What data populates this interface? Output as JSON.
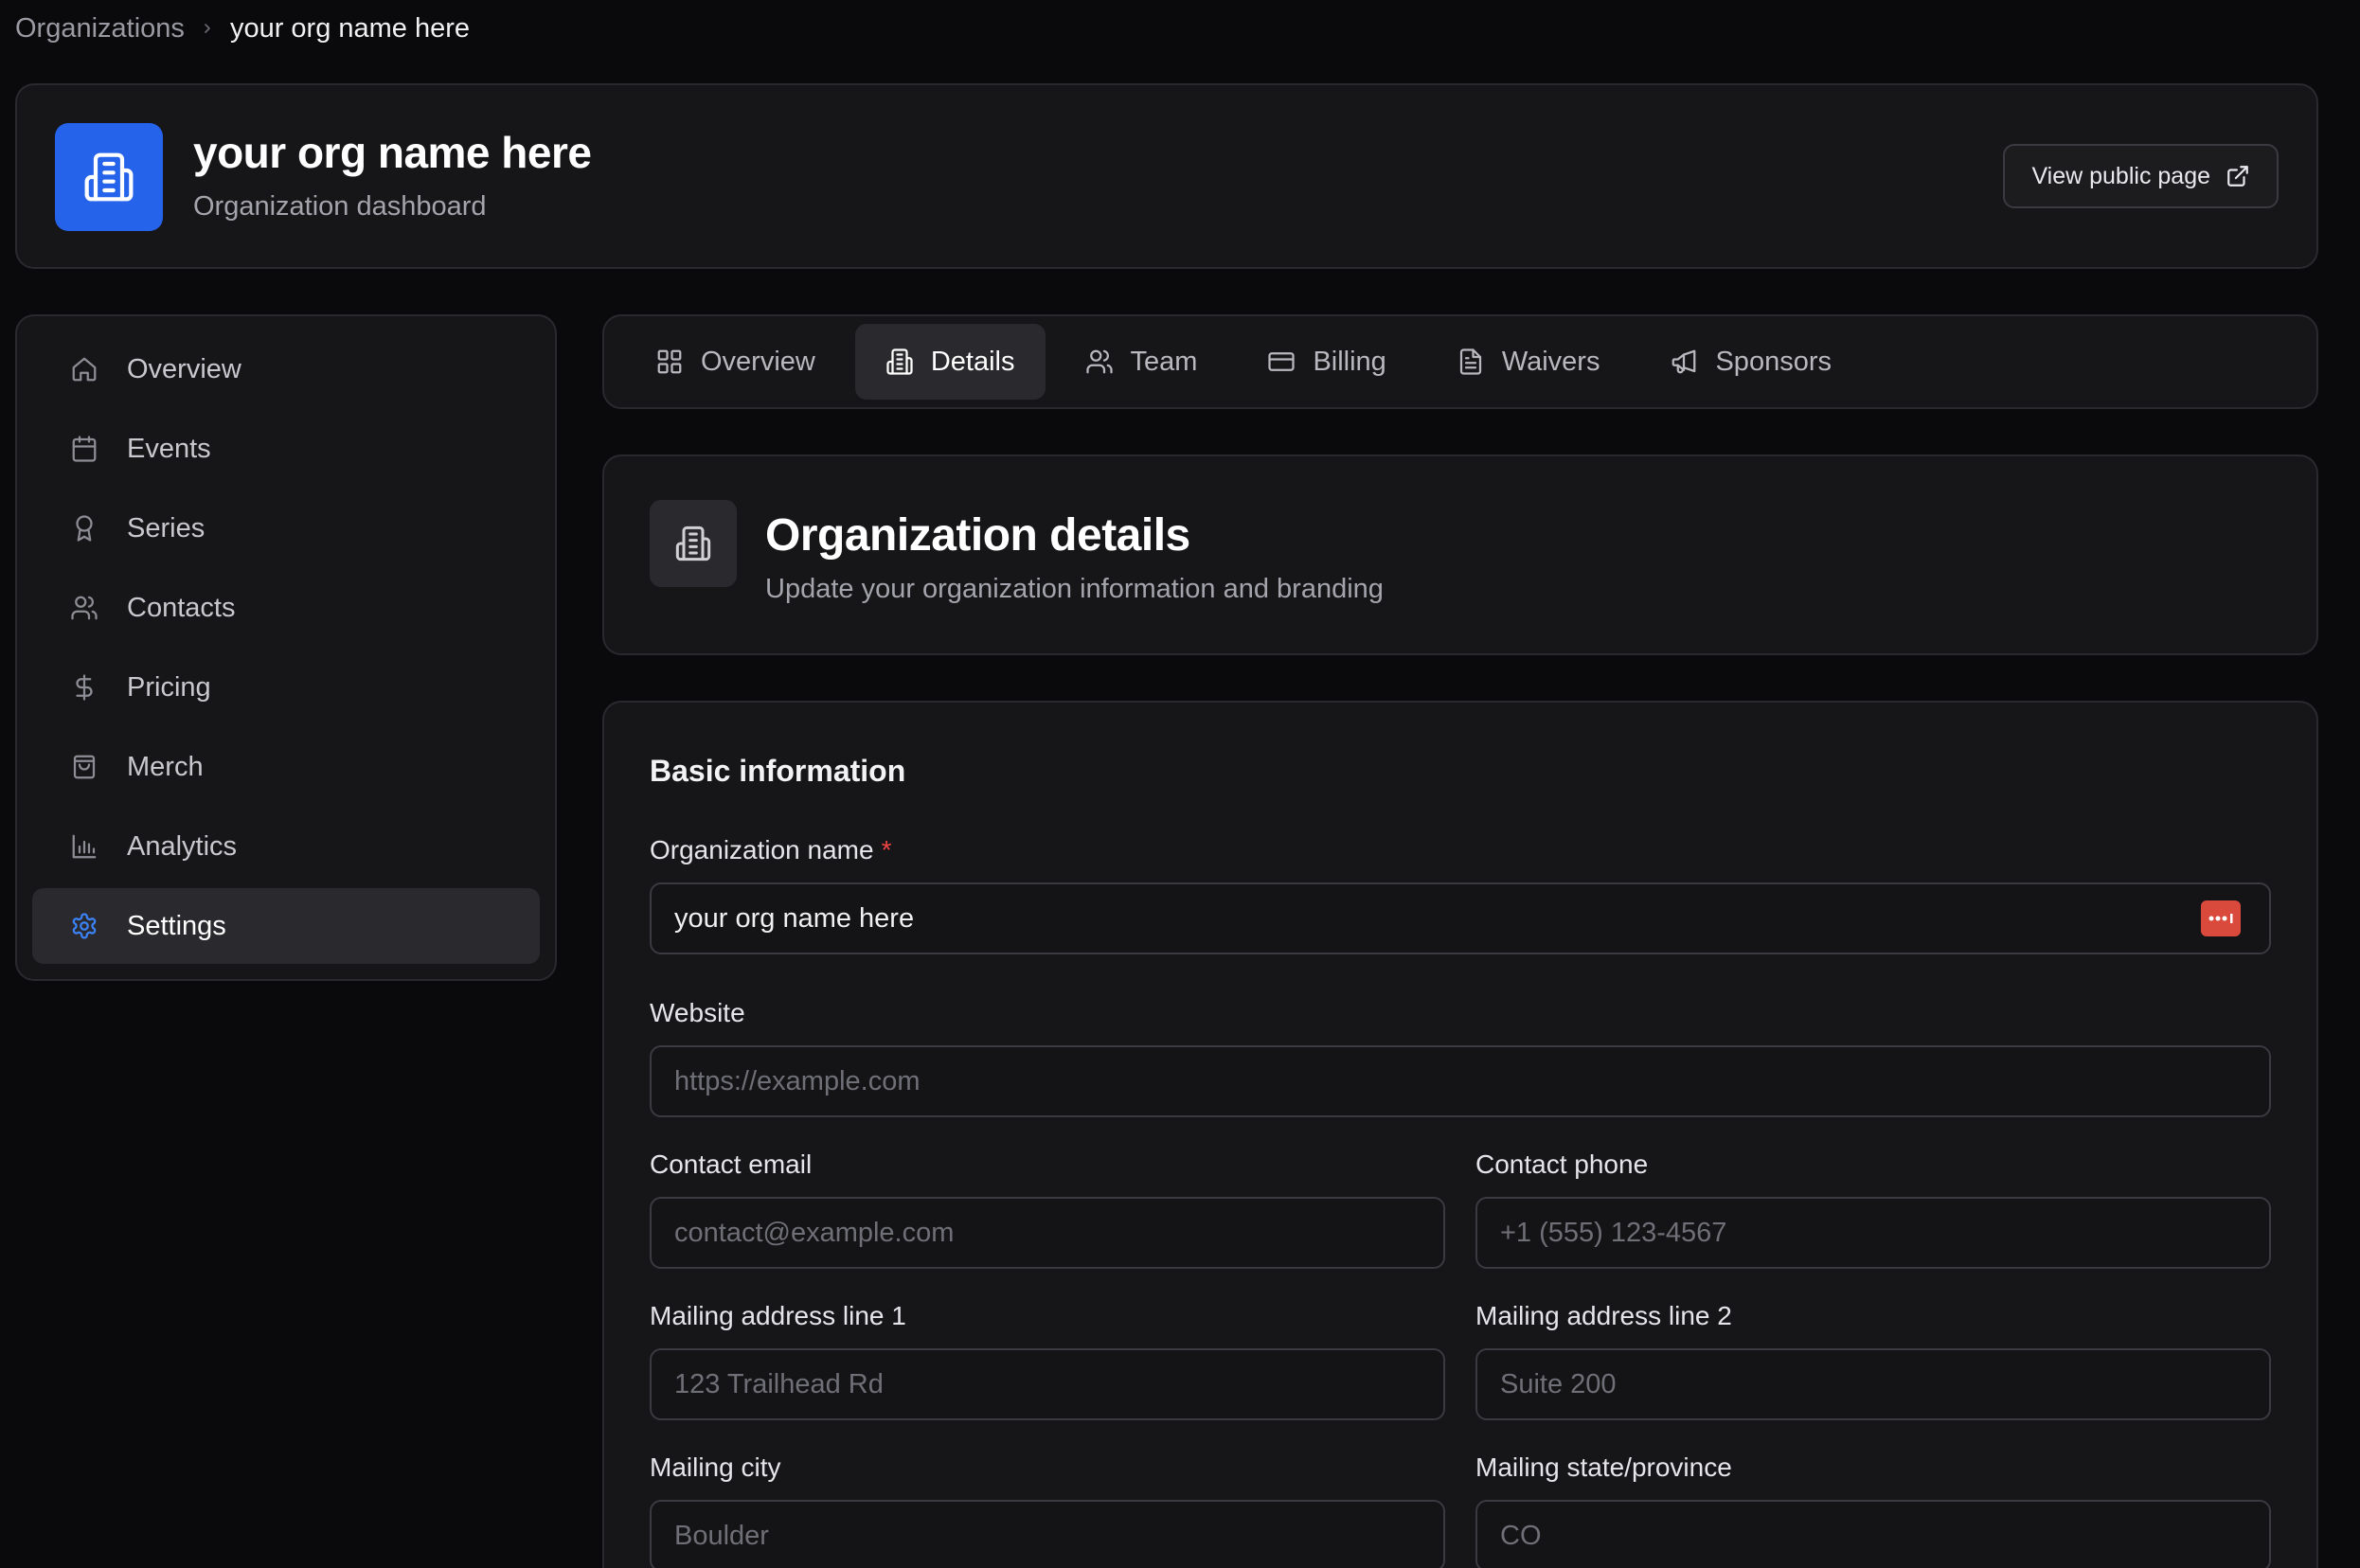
{
  "breadcrumb": {
    "root": "Organizations",
    "current": "your org name here"
  },
  "header": {
    "title": "your org name here",
    "subtitle": "Organization dashboard",
    "public_button": "View public page"
  },
  "sidebar": {
    "items": [
      {
        "label": "Overview",
        "icon": "home-icon"
      },
      {
        "label": "Events",
        "icon": "calendar-icon"
      },
      {
        "label": "Series",
        "icon": "award-icon"
      },
      {
        "label": "Contacts",
        "icon": "users-icon"
      },
      {
        "label": "Pricing",
        "icon": "dollar-icon"
      },
      {
        "label": "Merch",
        "icon": "shopping-bag-icon"
      },
      {
        "label": "Analytics",
        "icon": "bar-chart-icon"
      },
      {
        "label": "Settings",
        "icon": "gear-icon",
        "active": true
      }
    ]
  },
  "tabs": [
    {
      "label": "Overview",
      "icon": "grid-icon"
    },
    {
      "label": "Details",
      "icon": "building-icon",
      "active": true
    },
    {
      "label": "Team",
      "icon": "users-icon"
    },
    {
      "label": "Billing",
      "icon": "credit-card-icon"
    },
    {
      "label": "Waivers",
      "icon": "document-icon"
    },
    {
      "label": "Sponsors",
      "icon": "megaphone-icon"
    }
  ],
  "details": {
    "title": "Organization details",
    "subtitle": "Update your organization information and branding"
  },
  "form": {
    "section_title": "Basic information",
    "org_name": {
      "label": "Organization name",
      "required_mark": "*",
      "value": "your org name here"
    },
    "website": {
      "label": "Website",
      "placeholder": "https://example.com"
    },
    "contact_email": {
      "label": "Contact email",
      "placeholder": "contact@example.com"
    },
    "contact_phone": {
      "label": "Contact phone",
      "placeholder": "+1 (555) 123-4567"
    },
    "address1": {
      "label": "Mailing address line 1",
      "placeholder": "123 Trailhead Rd"
    },
    "address2": {
      "label": "Mailing address line 2",
      "placeholder": "Suite 200"
    },
    "city": {
      "label": "Mailing city",
      "placeholder": "Boulder"
    },
    "state": {
      "label": "Mailing state/province",
      "placeholder": "CO"
    }
  },
  "colors": {
    "accent": "#2563eb",
    "active_icon": "#3b82f6",
    "required": "#ef4444",
    "password_badge": "#d94a3d"
  }
}
